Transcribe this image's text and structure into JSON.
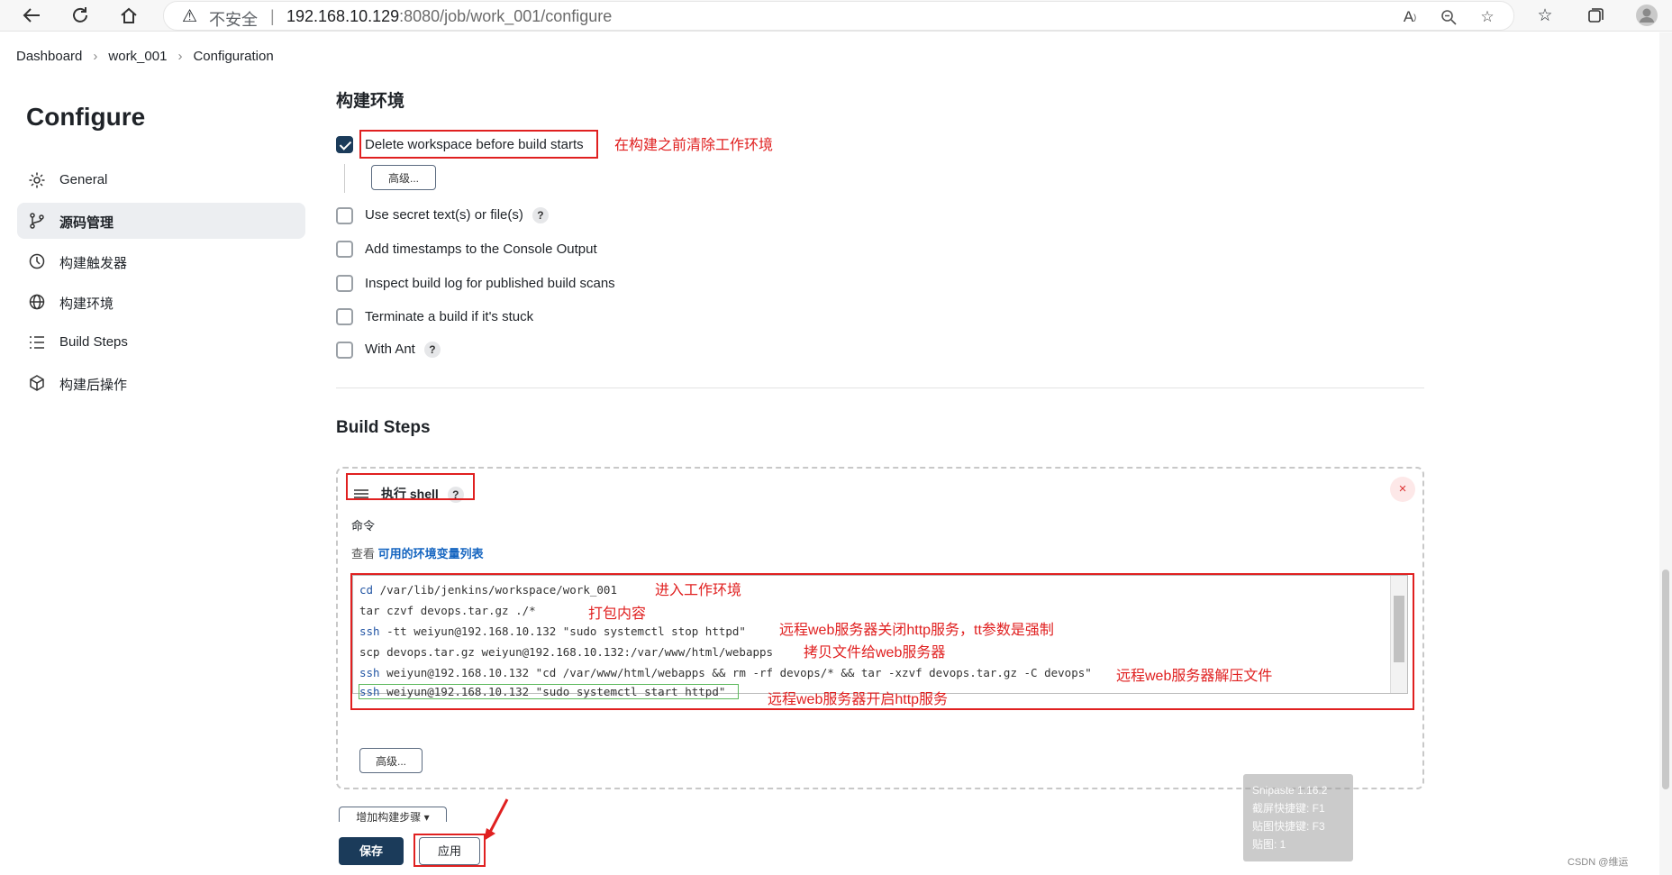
{
  "browser": {
    "security_label": "不安全",
    "url_host": "192.168.10.129",
    "url_path": ":8080/job/work_001/configure"
  },
  "breadcrumb": [
    "Dashboard",
    "work_001",
    "Configuration"
  ],
  "sidebar": {
    "title": "Configure",
    "items": [
      {
        "label": "General",
        "icon": "gear-icon"
      },
      {
        "label": "源码管理",
        "icon": "branch-icon",
        "active": true
      },
      {
        "label": "构建触发器",
        "icon": "clock-icon"
      },
      {
        "label": "构建环境",
        "icon": "globe-icon"
      },
      {
        "label": "Build Steps",
        "icon": "list-icon"
      },
      {
        "label": "构建后操作",
        "icon": "package-icon"
      }
    ]
  },
  "build_env": {
    "heading": "构建环境",
    "delete_workspace": {
      "label": "Delete workspace before build starts",
      "checked": true
    },
    "advanced_label": "高级...",
    "options": [
      {
        "label": "Use secret text(s) or file(s)",
        "help": "?"
      },
      {
        "label": "Add timestamps to the Console Output"
      },
      {
        "label": "Inspect build log for published build scans"
      },
      {
        "label": "Terminate a build if it's stuck"
      },
      {
        "label": "With Ant",
        "help": "?"
      }
    ]
  },
  "build_steps": {
    "heading": "Build Steps",
    "step_title": "执行 shell",
    "help": "?",
    "close": "×",
    "command_label": "命令",
    "env_prefix": "查看",
    "env_link": "可用的环境变量列表",
    "lines": [
      {
        "cmd": "cd",
        "rest": " /var/lib/jenkins/workspace/work_001"
      },
      {
        "cmd": "tar",
        "rest": " czvf devops.tar.gz ./*"
      },
      {
        "cmd": "ssh",
        "rest": " -tt weiyun@192.168.10.132 \"sudo systemctl stop httpd\""
      },
      {
        "cmd": "scp",
        "rest": " devops.tar.gz weiyun@192.168.10.132:/var/www/html/webapps"
      },
      {
        "cmd": "ssh",
        "rest": " weiyun@192.168.10.132 \"cd /var/www/html/webapps && rm -rf devops/* && tar -xzvf devops.tar.gz -C devops\""
      },
      {
        "cmd": "ssh",
        "rest": " weiyun@192.168.10.132 \"sudo systemctl start httpd\""
      }
    ],
    "advanced_label": "高级...",
    "add_step_label": "增加构建步骤"
  },
  "annotations": {
    "delete_ws": "在构建之前清除工作环境",
    "line1": "进入工作环境",
    "line2": "打包内容",
    "line3": "远程web服务器关闭http服务，tt参数是强制",
    "line4": "拷贝文件给web服务器",
    "line5": "远程web服务器解压文件",
    "line6": "远程web服务器开启http服务"
  },
  "footer": {
    "save_label": "保存",
    "apply_label": "应用"
  },
  "snipaste": {
    "lines": [
      "Snipaste 1.16.2",
      "截屏快捷键: F1",
      "贴图快捷键: F3",
      "贴图: 1"
    ]
  },
  "watermark": "CSDN @维运",
  "colors": {
    "primary": "#1b3b5a",
    "annotation": "#e02020",
    "link": "#1565c0",
    "command": "#2255a4"
  }
}
